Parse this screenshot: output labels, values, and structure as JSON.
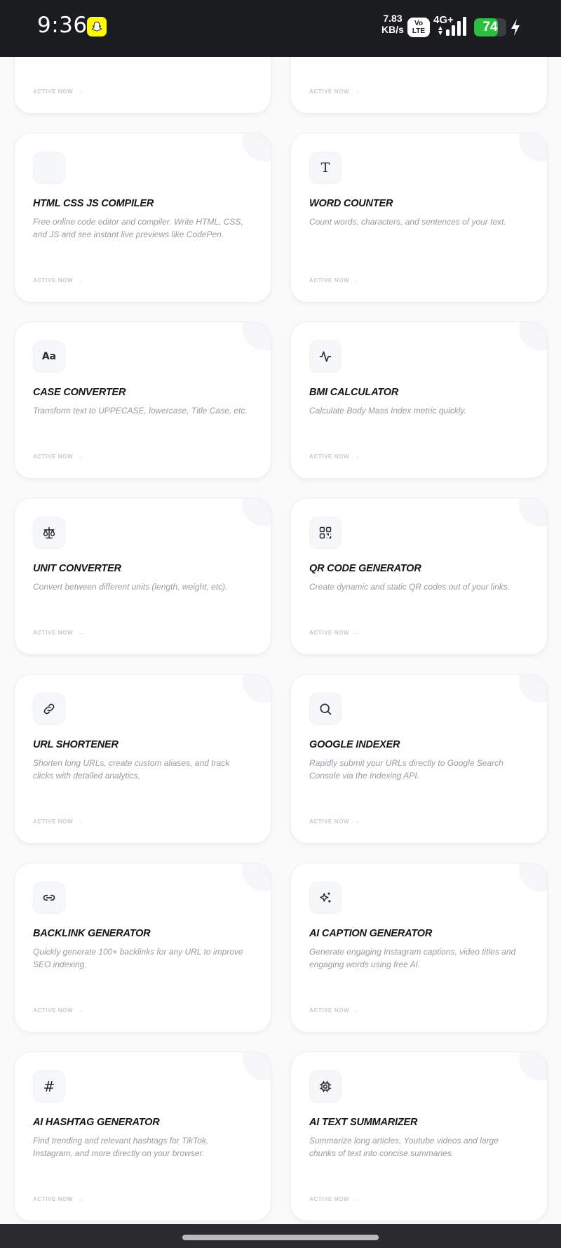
{
  "status_bar": {
    "time": "9:36",
    "net_speed_value": "7.83",
    "net_speed_unit": "KB/s",
    "volte_top": "Vo",
    "volte_bottom": "LTE",
    "network_type": "4G+",
    "battery_percent": "74",
    "battery_level": 0.74
  },
  "cards": [
    {
      "title": "",
      "description": "",
      "link": "ACTIVE NOW",
      "icon": ""
    },
    {
      "title": "",
      "description": "",
      "link": "ACTIVE NOW",
      "icon": ""
    },
    {
      "title": "HTML CSS JS COMPILER",
      "description": "Free online code editor and compiler. Write HTML, CSS, and JS and see instant live previews like CodePen.",
      "link": "ACTIVE NOW",
      "icon": "blank-icon"
    },
    {
      "title": "WORD COUNTER",
      "description": "Count words, characters, and sentences of your text.",
      "link": "ACTIVE NOW",
      "icon": "text-t-icon",
      "icon_text": "T"
    },
    {
      "title": "CASE CONVERTER",
      "description": "Transform text to UPPECASE, lowercase, Title Case, etc.",
      "link": "ACTIVE NOW",
      "icon": "case-aa-icon",
      "icon_text": "Aa"
    },
    {
      "title": "BMI CALCULATOR",
      "description": "Calculate Body Mass Index metric quickly.",
      "link": "ACTIVE NOW",
      "icon": "pulse-icon"
    },
    {
      "title": "UNIT CONVERTER",
      "description": "Convert between different units (length, weight, etc).",
      "link": "ACTIVE NOW",
      "icon": "scale-icon"
    },
    {
      "title": "QR CODE GENERATOR",
      "description": "Create dynamic and static QR codes out of your links.",
      "link": "ACTIVE NOW",
      "icon": "qr-code-icon"
    },
    {
      "title": "URL SHORTENER",
      "description": "Shorten long URLs, create custom aliases, and track clicks with detailed analytics.",
      "link": "ACTIVE NOW",
      "icon": "link-icon"
    },
    {
      "title": "GOOGLE INDEXER",
      "description": "Rapidly submit your URLs directly to Google Search Console via the Indexing API.",
      "link": "ACTIVE NOW",
      "icon": "search-icon"
    },
    {
      "title": "BACKLINK GENERATOR",
      "description": "Quickly generate 100+ backlinks for any URL to improve SEO indexing.",
      "link": "ACTIVE NOW",
      "icon": "chain-link-icon"
    },
    {
      "title": "AI CAPTION GENERATOR",
      "description": "Generate engaging Instagram captions, video titles and engaging words using free AI.",
      "link": "ACTIVE NOW",
      "icon": "sparkles-icon"
    },
    {
      "title": "AI HASHTAG GENERATOR",
      "description": "Find trending and relevant hashtags for TikTok, Instagram, and more directly on your browser.",
      "link": "ACTIVE NOW",
      "icon": "hash-icon",
      "icon_text": "#"
    },
    {
      "title": "AI TEXT SUMMARIZER",
      "description": "Summarize long articles, Youtube videos and large chunks of text into concise summaries.",
      "link": "ACTIVE NOW",
      "icon": "cpu-chip-icon"
    }
  ],
  "colors": {
    "status_bar_bg": "#1b1c20",
    "battery_green": "#2cbe3e",
    "page_bg": "#fafafa",
    "title_text": "#15151a",
    "desc_text": "#9a9ba3",
    "link_text": "#c8c9cf"
  }
}
